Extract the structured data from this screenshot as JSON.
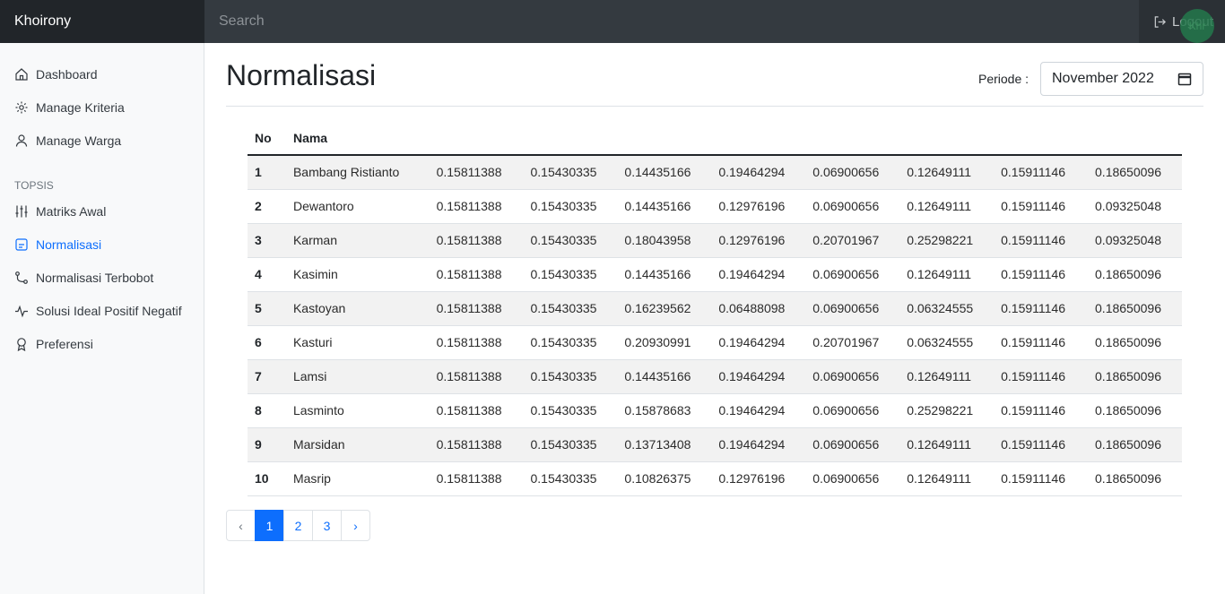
{
  "app": {
    "brand": "Khoirony"
  },
  "search": {
    "placeholder": "Search"
  },
  "header": {
    "logout_label": "Logout",
    "avatar_text": "Khr"
  },
  "sidebar": {
    "items": [
      {
        "label": "Dashboard",
        "icon": "home-icon"
      },
      {
        "label": "Manage Kriteria",
        "icon": "gear-icon"
      },
      {
        "label": "Manage Warga",
        "icon": "person-icon"
      }
    ],
    "section_heading": "TOPSIS",
    "topsis_items": [
      {
        "label": "Matriks Awal",
        "icon": "sliders-icon"
      },
      {
        "label": "Normalisasi",
        "icon": "form-icon",
        "active": true
      },
      {
        "label": "Normalisasi Terbobot",
        "icon": "bezier-icon"
      },
      {
        "label": "Solusi Ideal Positif Negatif",
        "icon": "activity-icon"
      },
      {
        "label": "Preferensi",
        "icon": "award-icon"
      }
    ]
  },
  "main": {
    "title": "Normalisasi",
    "period_label": "Periode :",
    "period_value": "November 2022"
  },
  "table": {
    "headers": [
      "No",
      "Nama",
      "",
      "",
      "",
      "",
      "",
      "",
      "",
      ""
    ],
    "rows": [
      [
        "1",
        "Bambang Ristianto",
        "0.15811388",
        "0.15430335",
        "0.14435166",
        "0.19464294",
        "0.06900656",
        "0.12649111",
        "0.15911146",
        "0.18650096"
      ],
      [
        "2",
        "Dewantoro",
        "0.15811388",
        "0.15430335",
        "0.14435166",
        "0.12976196",
        "0.06900656",
        "0.12649111",
        "0.15911146",
        "0.09325048"
      ],
      [
        "3",
        "Karman",
        "0.15811388",
        "0.15430335",
        "0.18043958",
        "0.12976196",
        "0.20701967",
        "0.25298221",
        "0.15911146",
        "0.09325048"
      ],
      [
        "4",
        "Kasimin",
        "0.15811388",
        "0.15430335",
        "0.14435166",
        "0.19464294",
        "0.06900656",
        "0.12649111",
        "0.15911146",
        "0.18650096"
      ],
      [
        "5",
        "Kastoyan",
        "0.15811388",
        "0.15430335",
        "0.16239562",
        "0.06488098",
        "0.06900656",
        "0.06324555",
        "0.15911146",
        "0.18650096"
      ],
      [
        "6",
        "Kasturi",
        "0.15811388",
        "0.15430335",
        "0.20930991",
        "0.19464294",
        "0.20701967",
        "0.06324555",
        "0.15911146",
        "0.18650096"
      ],
      [
        "7",
        "Lamsi",
        "0.15811388",
        "0.15430335",
        "0.14435166",
        "0.19464294",
        "0.06900656",
        "0.12649111",
        "0.15911146",
        "0.18650096"
      ],
      [
        "8",
        "Lasminto",
        "0.15811388",
        "0.15430335",
        "0.15878683",
        "0.19464294",
        "0.06900656",
        "0.25298221",
        "0.15911146",
        "0.18650096"
      ],
      [
        "9",
        "Marsidan",
        "0.15811388",
        "0.15430335",
        "0.13713408",
        "0.19464294",
        "0.06900656",
        "0.12649111",
        "0.15911146",
        "0.18650096"
      ],
      [
        "10",
        "Masrip",
        "0.15811388",
        "0.15430335",
        "0.10826375",
        "0.12976196",
        "0.06900656",
        "0.12649111",
        "0.15911146",
        "0.18650096"
      ]
    ]
  },
  "pagination": {
    "prev": "‹",
    "pages": [
      "1",
      "2",
      "3"
    ],
    "current": "1",
    "next": "›"
  },
  "colors": {
    "accent": "#0d6efd",
    "topbar": "#343a40",
    "brand_bg": "#212529",
    "sidebar_bg": "#f8f9fa"
  }
}
